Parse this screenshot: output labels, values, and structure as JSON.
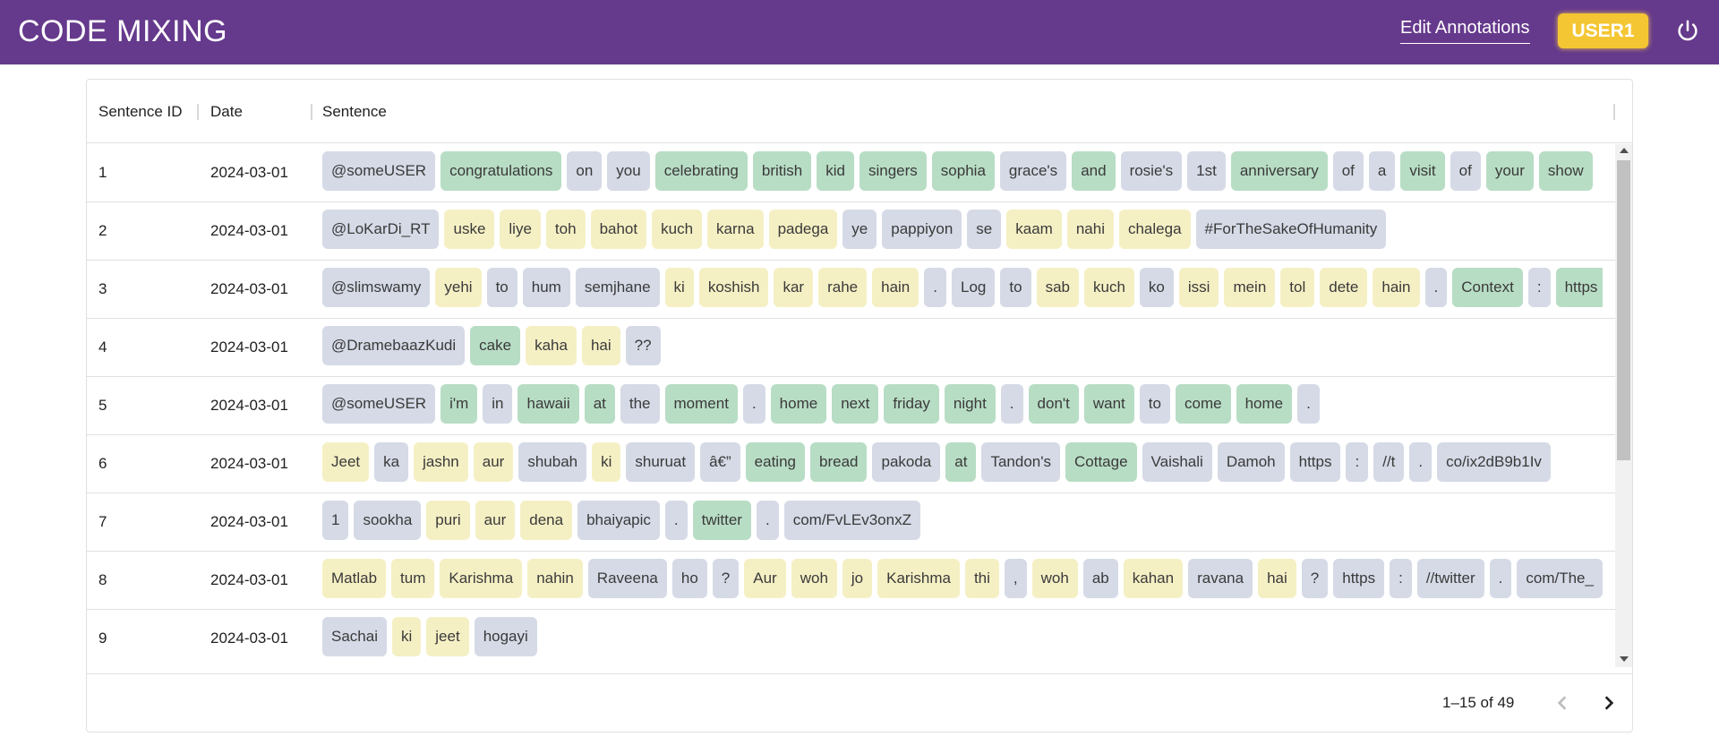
{
  "app": {
    "title": "CODE MIXING",
    "edit_link": "Edit Annotations",
    "user": "USER1"
  },
  "table": {
    "columns": [
      "Sentence ID",
      "Date",
      "Sentence"
    ],
    "rows": [
      {
        "id": "1",
        "date": "2024-03-01",
        "tokens": [
          {
            "t": "@someUSER",
            "c": "ot"
          },
          {
            "t": "congratulations",
            "c": "en"
          },
          {
            "t": "on",
            "c": "ot"
          },
          {
            "t": "you",
            "c": "ot"
          },
          {
            "t": "celebrating",
            "c": "en"
          },
          {
            "t": "british",
            "c": "en"
          },
          {
            "t": "kid",
            "c": "en"
          },
          {
            "t": "singers",
            "c": "en"
          },
          {
            "t": "sophia",
            "c": "en"
          },
          {
            "t": "grace's",
            "c": "ot"
          },
          {
            "t": "and",
            "c": "en"
          },
          {
            "t": "rosie's",
            "c": "ot"
          },
          {
            "t": "1st",
            "c": "ot"
          },
          {
            "t": "anniversary",
            "c": "en"
          },
          {
            "t": "of",
            "c": "ot"
          },
          {
            "t": "a",
            "c": "ot"
          },
          {
            "t": "visit",
            "c": "en"
          },
          {
            "t": "of",
            "c": "ot"
          },
          {
            "t": "your",
            "c": "en"
          },
          {
            "t": "show",
            "c": "en"
          }
        ]
      },
      {
        "id": "2",
        "date": "2024-03-01",
        "tokens": [
          {
            "t": "@LoKarDi_RT",
            "c": "ot"
          },
          {
            "t": "uske",
            "c": "hi"
          },
          {
            "t": "liye",
            "c": "hi"
          },
          {
            "t": "toh",
            "c": "hi"
          },
          {
            "t": "bahot",
            "c": "hi"
          },
          {
            "t": "kuch",
            "c": "hi"
          },
          {
            "t": "karna",
            "c": "hi"
          },
          {
            "t": "padega",
            "c": "hi"
          },
          {
            "t": "ye",
            "c": "ot"
          },
          {
            "t": "pappiyon",
            "c": "ot"
          },
          {
            "t": "se",
            "c": "ot"
          },
          {
            "t": "kaam",
            "c": "hi"
          },
          {
            "t": "nahi",
            "c": "hi"
          },
          {
            "t": "chalega",
            "c": "hi"
          },
          {
            "t": "#ForTheSakeOfHumanity",
            "c": "ot"
          }
        ]
      },
      {
        "id": "3",
        "date": "2024-03-01",
        "tokens": [
          {
            "t": "@slimswamy",
            "c": "ot"
          },
          {
            "t": "yehi",
            "c": "hi"
          },
          {
            "t": "to",
            "c": "ot"
          },
          {
            "t": "hum",
            "c": "ot"
          },
          {
            "t": "semjhane",
            "c": "ot"
          },
          {
            "t": "ki",
            "c": "hi"
          },
          {
            "t": "koshish",
            "c": "hi"
          },
          {
            "t": "kar",
            "c": "hi"
          },
          {
            "t": "rahe",
            "c": "hi"
          },
          {
            "t": "hain",
            "c": "hi"
          },
          {
            "t": ".",
            "c": "ot"
          },
          {
            "t": "Log",
            "c": "ot"
          },
          {
            "t": "to",
            "c": "ot"
          },
          {
            "t": "sab",
            "c": "hi"
          },
          {
            "t": "kuch",
            "c": "hi"
          },
          {
            "t": "ko",
            "c": "ot"
          },
          {
            "t": "issi",
            "c": "hi"
          },
          {
            "t": "mein",
            "c": "hi"
          },
          {
            "t": "tol",
            "c": "hi"
          },
          {
            "t": "dete",
            "c": "hi"
          },
          {
            "t": "hain",
            "c": "hi"
          },
          {
            "t": ".",
            "c": "ot"
          },
          {
            "t": "Context",
            "c": "en"
          },
          {
            "t": ":",
            "c": "ot"
          },
          {
            "t": "https",
            "c": "en"
          }
        ]
      },
      {
        "id": "4",
        "date": "2024-03-01",
        "tokens": [
          {
            "t": "@DramebaazKudi",
            "c": "ot"
          },
          {
            "t": "cake",
            "c": "en"
          },
          {
            "t": "kaha",
            "c": "hi"
          },
          {
            "t": "hai",
            "c": "hi"
          },
          {
            "t": "??",
            "c": "ot"
          }
        ]
      },
      {
        "id": "5",
        "date": "2024-03-01",
        "tokens": [
          {
            "t": "@someUSER",
            "c": "ot"
          },
          {
            "t": "i'm",
            "c": "en"
          },
          {
            "t": "in",
            "c": "ot"
          },
          {
            "t": "hawaii",
            "c": "en"
          },
          {
            "t": "at",
            "c": "en"
          },
          {
            "t": "the",
            "c": "ot"
          },
          {
            "t": "moment",
            "c": "en"
          },
          {
            "t": ".",
            "c": "ot"
          },
          {
            "t": "home",
            "c": "en"
          },
          {
            "t": "next",
            "c": "en"
          },
          {
            "t": "friday",
            "c": "en"
          },
          {
            "t": "night",
            "c": "en"
          },
          {
            "t": ".",
            "c": "ot"
          },
          {
            "t": "don't",
            "c": "en"
          },
          {
            "t": "want",
            "c": "en"
          },
          {
            "t": "to",
            "c": "ot"
          },
          {
            "t": "come",
            "c": "en"
          },
          {
            "t": "home",
            "c": "en"
          },
          {
            "t": ".",
            "c": "ot"
          }
        ]
      },
      {
        "id": "6",
        "date": "2024-03-01",
        "tokens": [
          {
            "t": "Jeet",
            "c": "hi"
          },
          {
            "t": "ka",
            "c": "ot"
          },
          {
            "t": "jashn",
            "c": "hi"
          },
          {
            "t": "aur",
            "c": "hi"
          },
          {
            "t": "shubah",
            "c": "ot"
          },
          {
            "t": "ki",
            "c": "hi"
          },
          {
            "t": "shuruat",
            "c": "ot"
          },
          {
            "t": "â€”",
            "c": "ot"
          },
          {
            "t": "eating",
            "c": "en"
          },
          {
            "t": "bread",
            "c": "en"
          },
          {
            "t": "pakoda",
            "c": "ot"
          },
          {
            "t": "at",
            "c": "en"
          },
          {
            "t": "Tandon's",
            "c": "ot"
          },
          {
            "t": "Cottage",
            "c": "en"
          },
          {
            "t": "Vaishali",
            "c": "ot"
          },
          {
            "t": "Damoh",
            "c": "ot"
          },
          {
            "t": "https",
            "c": "ot"
          },
          {
            "t": ":",
            "c": "ot"
          },
          {
            "t": "//t",
            "c": "ot"
          },
          {
            "t": ".",
            "c": "ot"
          },
          {
            "t": "co/ix2dB9b1Iv",
            "c": "ot"
          }
        ]
      },
      {
        "id": "7",
        "date": "2024-03-01",
        "tokens": [
          {
            "t": "1",
            "c": "ot"
          },
          {
            "t": "sookha",
            "c": "ot"
          },
          {
            "t": "puri",
            "c": "hi"
          },
          {
            "t": "aur",
            "c": "hi"
          },
          {
            "t": "dena",
            "c": "hi"
          },
          {
            "t": "bhaiyapic",
            "c": "ot"
          },
          {
            "t": ".",
            "c": "ot"
          },
          {
            "t": "twitter",
            "c": "en"
          },
          {
            "t": ".",
            "c": "ot"
          },
          {
            "t": "com/FvLEv3onxZ",
            "c": "ot"
          }
        ]
      },
      {
        "id": "8",
        "date": "2024-03-01",
        "tokens": [
          {
            "t": "Matlab",
            "c": "hi"
          },
          {
            "t": "tum",
            "c": "hi"
          },
          {
            "t": "Karishma",
            "c": "hi"
          },
          {
            "t": "nahin",
            "c": "hi"
          },
          {
            "t": "Raveena",
            "c": "ot"
          },
          {
            "t": "ho",
            "c": "ot"
          },
          {
            "t": "?",
            "c": "ot"
          },
          {
            "t": "Aur",
            "c": "hi"
          },
          {
            "t": "woh",
            "c": "hi"
          },
          {
            "t": "jo",
            "c": "hi"
          },
          {
            "t": "Karishma",
            "c": "hi"
          },
          {
            "t": "thi",
            "c": "hi"
          },
          {
            "t": ",",
            "c": "ot"
          },
          {
            "t": "woh",
            "c": "hi"
          },
          {
            "t": "ab",
            "c": "ot"
          },
          {
            "t": "kahan",
            "c": "hi"
          },
          {
            "t": "ravana",
            "c": "ot"
          },
          {
            "t": "hai",
            "c": "hi"
          },
          {
            "t": "?",
            "c": "ot"
          },
          {
            "t": "https",
            "c": "ot"
          },
          {
            "t": ":",
            "c": "ot"
          },
          {
            "t": "//twitter",
            "c": "ot"
          },
          {
            "t": ".",
            "c": "ot"
          },
          {
            "t": "com/The_",
            "c": "ot"
          }
        ]
      },
      {
        "id": "9",
        "date": "2024-03-01",
        "tokens": [
          {
            "t": "Sachai",
            "c": "ot"
          },
          {
            "t": "ki",
            "c": "hi"
          },
          {
            "t": "jeet",
            "c": "hi"
          },
          {
            "t": "hogayi",
            "c": "ot"
          }
        ]
      }
    ]
  },
  "pagination": {
    "label": "1–15 of 49"
  },
  "colors": {
    "appbar": "#65398c",
    "user_badge": "#f4c633",
    "token_english": "#b8ddc5",
    "token_hindi": "#f5f0c4",
    "token_other": "#d5dae6"
  },
  "icons": {
    "logout": "power-icon",
    "prev": "chevron-left-icon",
    "next": "chevron-right-icon"
  }
}
